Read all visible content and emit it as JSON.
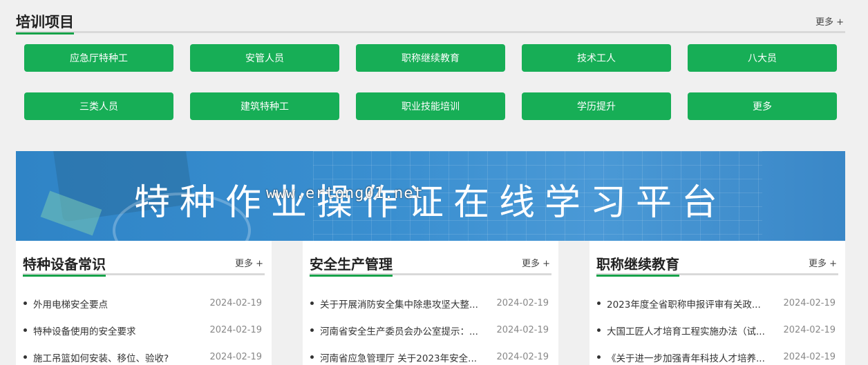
{
  "training": {
    "title": "培训项目",
    "more": "更多 +",
    "items": [
      "应急厅特种工",
      "安管人员",
      "职称继续教育",
      "技术工人",
      "八大员",
      "三类人员",
      "建筑特种工",
      "职业技能培训",
      "学历提升",
      "更多"
    ]
  },
  "banner": {
    "title": "特种作业操作证在线学习平台",
    "watermark": "www.ertong01.net"
  },
  "cards": [
    {
      "title": "特种设备常识",
      "more": "更多 +",
      "items": [
        {
          "title": "外用电梯安全要点",
          "date": "2024-02-19"
        },
        {
          "title": "特种设备使用的安全要求",
          "date": "2024-02-19"
        },
        {
          "title": "施工吊篮如何安装、移位、验收?",
          "date": "2024-02-19"
        }
      ]
    },
    {
      "title": "安全生产管理",
      "more": "更多 +",
      "items": [
        {
          "title": "关于开展消防安全集中除患攻坚大整...",
          "date": "2024-02-19"
        },
        {
          "title": "河南省安全生产委员会办公室提示：...",
          "date": "2024-02-19"
        },
        {
          "title": "河南省应急管理厅 关于2023年安全...",
          "date": "2024-02-19"
        }
      ]
    },
    {
      "title": "职称继续教育",
      "more": "更多 +",
      "items": [
        {
          "title": "2023年度全省职称申报评审有关政...",
          "date": "2024-02-19"
        },
        {
          "title": "大国工匠人才培育工程实施办法（试...",
          "date": "2024-02-19"
        },
        {
          "title": "《关于进一步加强青年科技人才培养...",
          "date": "2024-02-19"
        }
      ]
    }
  ]
}
